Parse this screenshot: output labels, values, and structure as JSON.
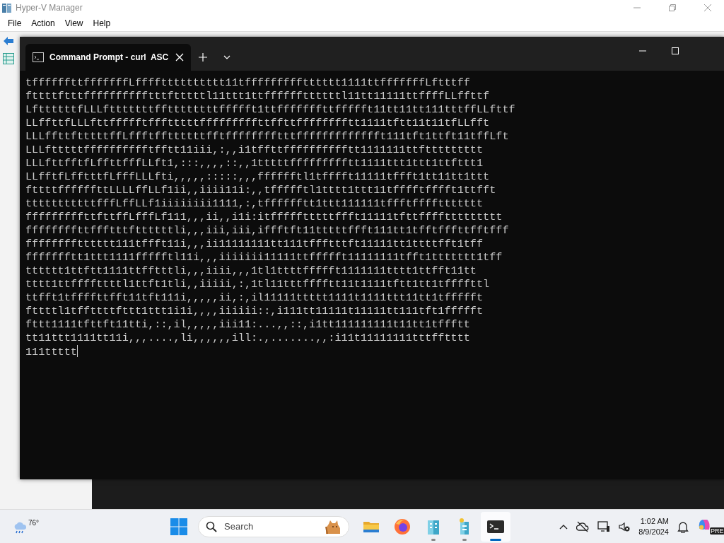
{
  "background_window": {
    "title": "Hyper-V Manager",
    "menu": [
      "File",
      "Action",
      "View",
      "Help"
    ]
  },
  "terminal": {
    "tabs": [
      {
        "title": "Command Prompt - curl  ASC",
        "selected": true
      }
    ],
    "lines": [
      "tffffffttfffffffLfffftttttttttt11tffffffffftttttt1111ttfffffffLftttff",
      "fttttftttfffffffffftttftttttl11ttt1ttffffffttttttl11tt11111ttffffLLffttf",
      "LfttttttfLLLftttttttffttttttttffffft1ttfffffffttffffft11tt11tt111tttffLLfttf",
      "LLffttfLLLfttffffftffftttttfffffffffttffttfffffffftt1111tftt11t11tfLLfft",
      "LLLffttftttttffLffftffttttttfftfffffffftttffffffffffffft111tft1ttft11tffLft",
      "LLLftttttfffffffffftfftt11iii,:,,i1tffttfffffffffftt1111111ttfttttttttt",
      "LLLfttfftfLffttfffLLft1,:::,,,,::,,1tttttffffffffftt1111ttt1ttt1ttfttt1",
      "LLfftfLfftttfLfffLLLfti,,,,,:::::,,,fffffftl1tfffft11111tffft1tt11tt1ttt",
      "fttttffffffttLLLLffLLf1ii,,iiii11i:,,tffffftl1tttt1ttt11tfffftfffft1ttfft",
      "tttttttttttfffLffLLf1iiiiiiii1111,:,tfffffftt1ttt111111tffftffffttttttt",
      "fffffffffttfttffLfffLf111,,,ii,,i1i:itffffftttttffft11111tfttffffttttttttt",
      "ffffffffttffftttfttttttli,,,iii,iii,iffftft11tttttffft111tt1tfftfffttfftfff",
      "fffffffftttttt111tffft11i,,,ii11111111tt111tffftttft11111tt1ttttfft1tff",
      "ffffffftt1ttt1111ffffftl11i,,,iiiiiii11111ttffffft11111111tfft1ttttttt1tff",
      "tttttt1ttftt1111ttfftttli,,,iiii,,,1tl1ttttffffft1111111tttt1ttfft11tt",
      "tttt1ttffffttttl1ttft1tli,,iiiii,:,1tl11tttfffftt11t1111tftt1tt1tffffttl",
      "ttfft1tffffttfft11tft111i,,,,,ii,:,il11111ttttt1111t1111ttt11tt1tffffft",
      "fttttl1tffttttfttt1ttt1i1i,,,,iiiiii::,i111tt11111t11111tt111tft1ffffft",
      "fttt1111tfttft11tti,::,il,,,,,iii11:...,,::,i1tt111111111t11tt1tffftt",
      "tt11ttt1111tt11i,,,....,li,,,,,,ill:.,.......,,:i11t11111111tttfftttt",
      "111ttttt"
    ]
  },
  "taskbar": {
    "weather": {
      "temperature": "76°"
    },
    "search": {
      "placeholder": "Search"
    },
    "apps": [
      {
        "kind": "folder",
        "running": false,
        "active": false
      },
      {
        "kind": "firefox",
        "running": false,
        "active": false
      },
      {
        "kind": "building",
        "running": true,
        "active": false
      },
      {
        "kind": "building2",
        "running": true,
        "active": false
      },
      {
        "kind": "terminal",
        "running": true,
        "active": true
      }
    ],
    "clock": {
      "time": "1:02 AM",
      "date": "8/9/2024"
    },
    "copilot_badge": "PRE"
  }
}
